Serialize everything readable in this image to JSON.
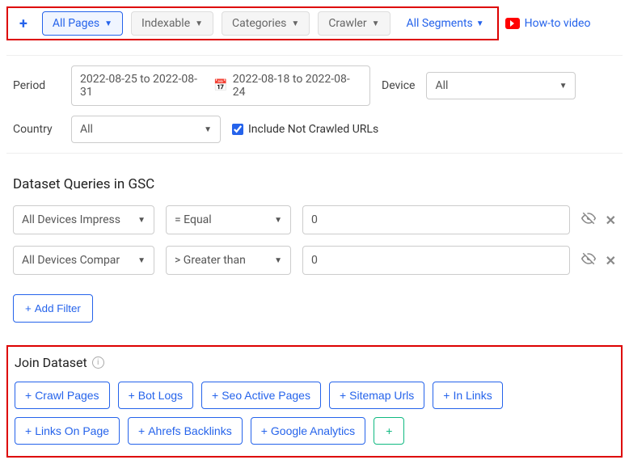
{
  "topTabs": {
    "allPages": "All Pages",
    "indexable": "Indexable",
    "categories": "Categories",
    "crawler": "Crawler",
    "segments": "All Segments"
  },
  "howto": "How-to video",
  "filters": {
    "periodLabel": "Period",
    "period1": "2022-08-25 to 2022-08-31",
    "period2": "2022-08-18 to 2022-08-24",
    "deviceLabel": "Device",
    "deviceValue": "All",
    "countryLabel": "Country",
    "countryValue": "All",
    "includeNotCrawled": "Include Not Crawled URLs"
  },
  "datasetQueries": {
    "title": "Dataset Queries in GSC",
    "rows": [
      {
        "metric": "All Devices Impress",
        "op": "= Equal",
        "value": "0"
      },
      {
        "metric": "All Devices Compar",
        "op": "> Greater than",
        "value": "0"
      }
    ],
    "addFilter": "Add Filter"
  },
  "joinDataset": {
    "title": "Join Dataset",
    "buttons": [
      "Crawl Pages",
      "Bot Logs",
      "Seo Active Pages",
      "Sitemap Urls",
      "In Links",
      "Links On Page",
      "Ahrefs Backlinks",
      "Google Analytics"
    ]
  }
}
